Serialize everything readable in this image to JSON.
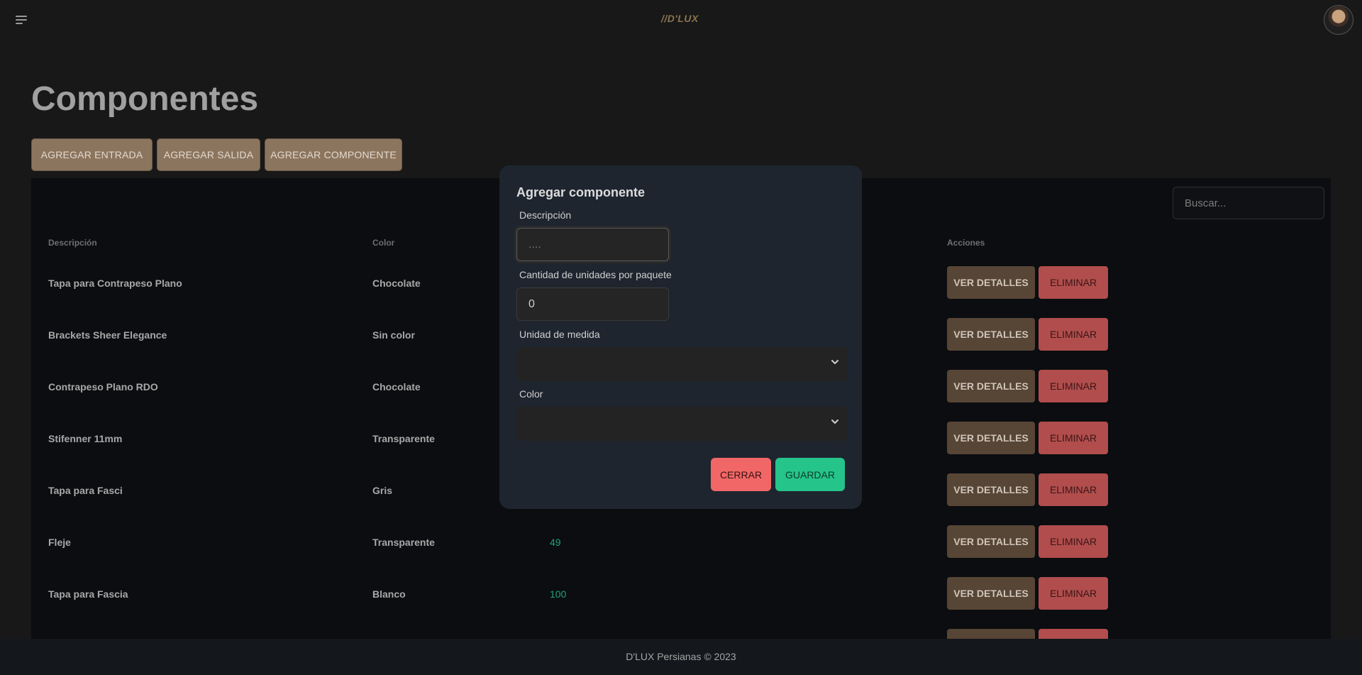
{
  "header": {
    "logo": "//D'LUX"
  },
  "page": {
    "title": "Componentes",
    "actions": [
      "AGREGAR ENTRADA",
      "AGREGAR SALIDA",
      "AGREGAR COMPONENTE"
    ]
  },
  "search": {
    "placeholder": "Buscar..."
  },
  "table": {
    "headers": {
      "description": "Descripción",
      "color": "Color",
      "actions": "Acciones"
    },
    "details_label": "VER DETALLES",
    "delete_label": "ELIMINAR",
    "rows": [
      {
        "description": "Tapa para Contrapeso Plano",
        "color": "Chocolate",
        "quantity": ""
      },
      {
        "description": "Brackets Sheer Elegance",
        "color": "Sin color",
        "quantity": ""
      },
      {
        "description": "Contrapeso Plano RDO",
        "color": "Chocolate",
        "quantity": ""
      },
      {
        "description": "Stifenner 11mm",
        "color": "Transparente",
        "quantity": ""
      },
      {
        "description": "Tapa para Fasci",
        "color": "Gris",
        "quantity": ""
      },
      {
        "description": "Fleje",
        "color": "Transparente",
        "quantity": "49"
      },
      {
        "description": "Tapa para Fascia",
        "color": "Blanco",
        "quantity": "100"
      },
      {
        "description": "",
        "color": "",
        "quantity": ""
      }
    ]
  },
  "modal": {
    "title": "Agregar componente",
    "description_label": "Descripción",
    "description_placeholder": "....",
    "units_label": "Cantidad de unidades por paquete",
    "units_value": "0",
    "unit_label": "Unidad de medida",
    "color_label": "Color",
    "close_label": "CERRAR",
    "save_label": "GUARDAR"
  },
  "footer": {
    "text": "D'LUX Persianas © 2023"
  },
  "colors": {
    "accent": "#8c755f",
    "danger": "#b14d4d",
    "success": "#25c48a",
    "quantity": "#1fa27a"
  }
}
